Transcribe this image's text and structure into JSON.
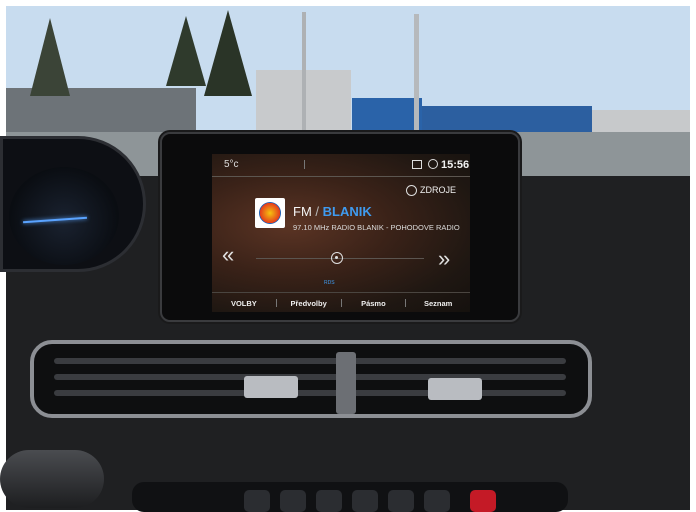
{
  "status_bar": {
    "temperature": "5°c",
    "time": "15:56"
  },
  "source": {
    "label": "ZDROJE",
    "icon": "broadcast-icon"
  },
  "radio": {
    "band": "FM",
    "separator": "/",
    "station": "BLANIK",
    "frequency_info": "97.10 MHz  RADIO BLANIK - POHODOVE RADIO",
    "rds": "RDS"
  },
  "controls": {
    "prev_label": "«",
    "next_label": "»"
  },
  "menu": {
    "items": [
      "VOLBY",
      "Předvolby",
      "Pásmo",
      "Seznam"
    ]
  },
  "colors": {
    "accent": "#3f9bf0",
    "hazard": "#c41a26"
  }
}
